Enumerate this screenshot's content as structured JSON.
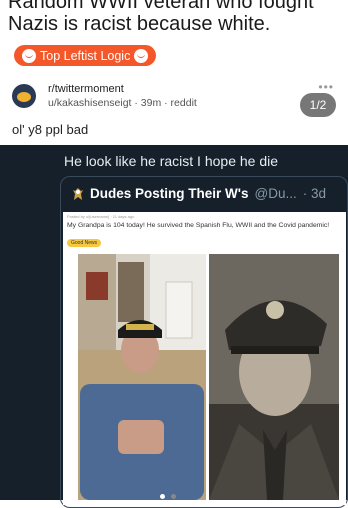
{
  "post": {
    "title": "Random WWII veteran who fought Nazis is racist because white.",
    "flair": "Top Leftist Logic",
    "subreddit": "r/twittermoment",
    "meta": "u/kakashisenseigt · 39m · reddit",
    "more": "•••",
    "pager": "1/2",
    "caption": "ol' y8 ppl bad"
  },
  "tweet": {
    "text": "He look like he racist I hope he die",
    "quote": {
      "account": "Dudes Posting Their W's",
      "handle": "@Du...",
      "age": "· 3d",
      "inner_meta": "Posted by u/[username] · 11 days ago",
      "post_title": "My Grandpa is 104 today! He survived the Spanish Flu, WWII and the Covid pandemic!",
      "award": "Good News"
    }
  },
  "colors": {
    "flair_bg": "#f3572a",
    "tweet_bg": "#15202b",
    "pager_bg": "#777777"
  }
}
